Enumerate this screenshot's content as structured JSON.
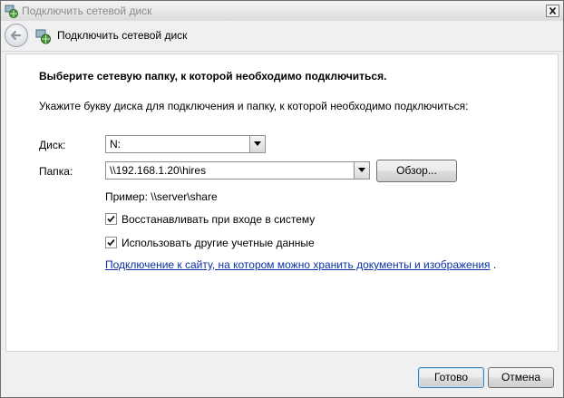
{
  "window": {
    "title": "Подключить сетевой диск"
  },
  "nav": {
    "title": "Подключить сетевой диск"
  },
  "main": {
    "heading": "Выберите сетевую папку, к которой необходимо подключиться.",
    "instruction": "Укажите букву диска для подключения и папку, к которой необходимо подключиться:",
    "drive": {
      "label": "Диск:",
      "value": "N:"
    },
    "folder": {
      "label": "Папка:",
      "value": "\\\\192.168.1.20\\hires"
    },
    "browse_label": "Обзор...",
    "example": "Пример: \\\\server\\share",
    "reconnect": {
      "label": "Восстанавливать при входе в систему",
      "checked": true
    },
    "other_credentials": {
      "label": "Использовать другие учетные данные",
      "checked": true
    },
    "link_text": "Подключение к сайту, на котором можно хранить документы и изображения",
    "link_suffix": "."
  },
  "footer": {
    "finish_label": "Готово",
    "cancel_label": "Отмена"
  },
  "icons": {
    "title": "network-drive-icon",
    "back": "back-arrow-icon",
    "close": "close-icon",
    "dropdown": "chevron-down-icon",
    "check": "checkmark-icon"
  }
}
